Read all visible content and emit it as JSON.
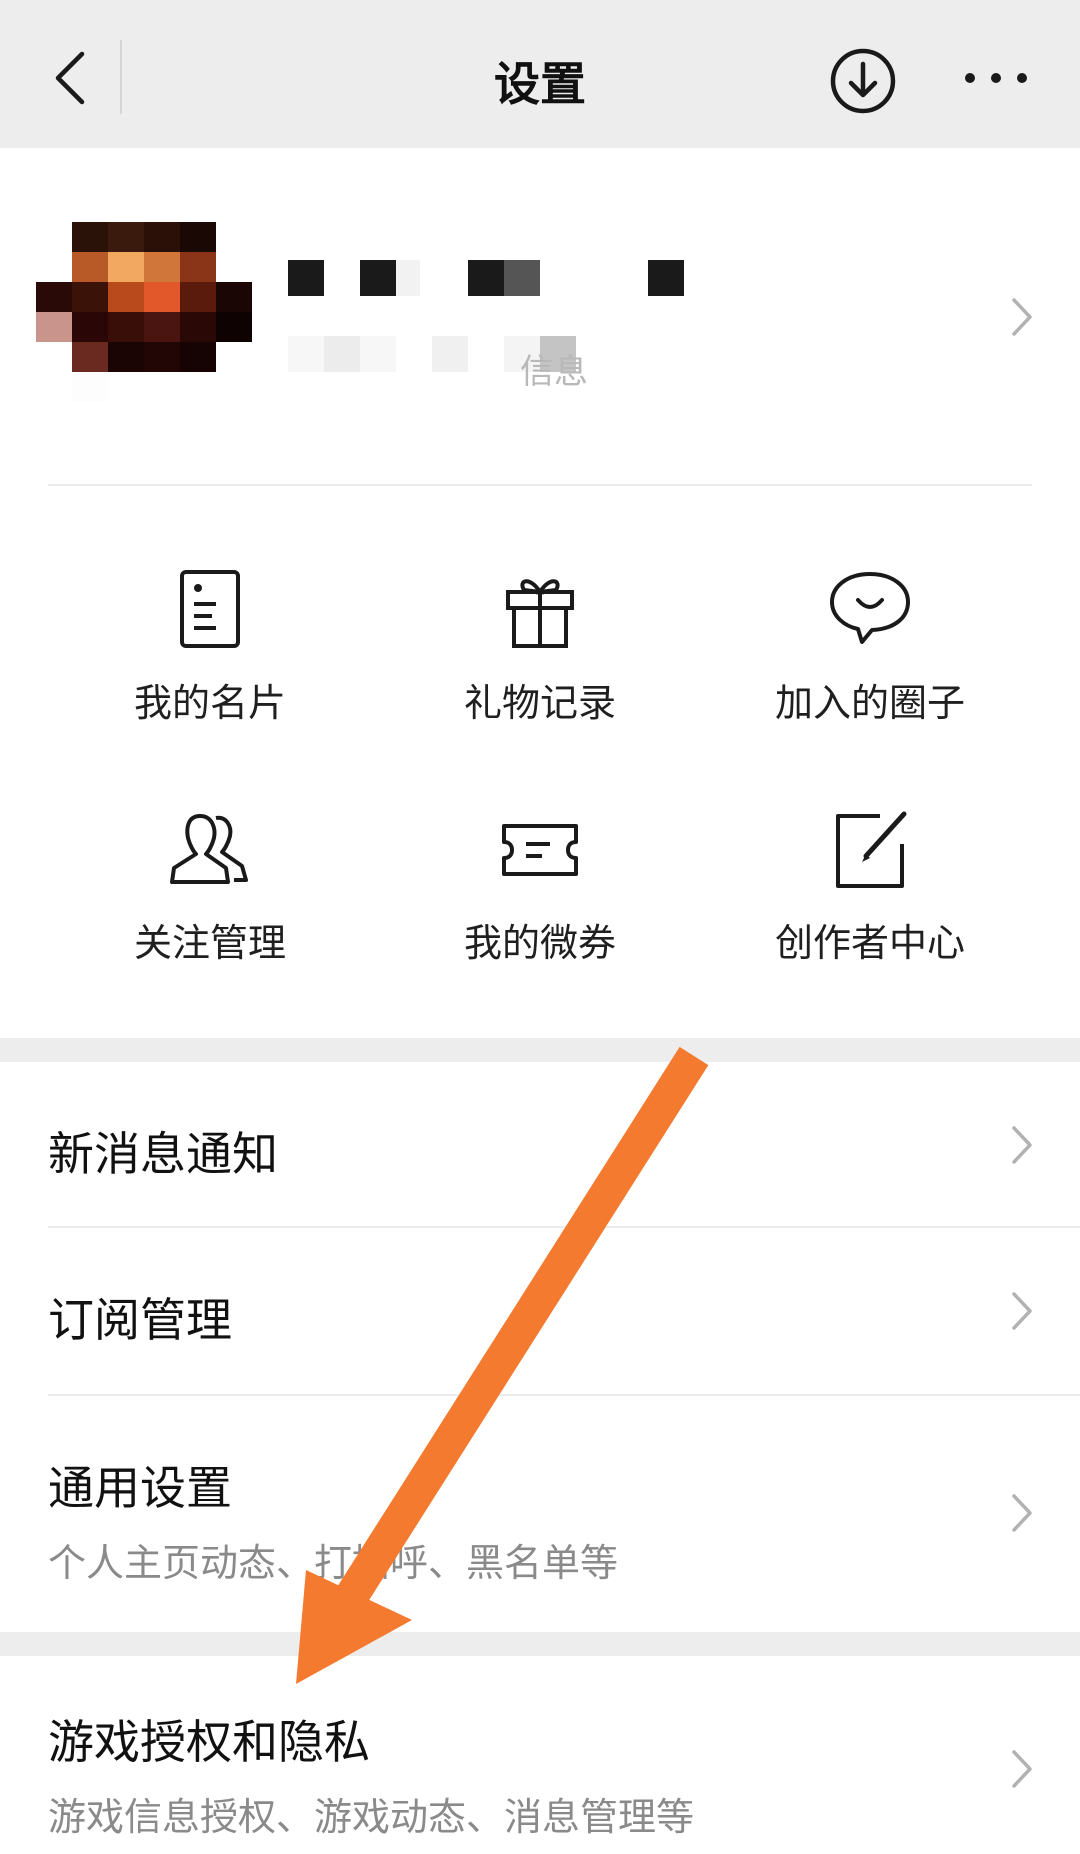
{
  "header": {
    "title": "设置",
    "back_icon": "back-chevron-icon",
    "download_icon": "download-circle-icon",
    "more_icon": "more-dots-icon"
  },
  "profile": {
    "description_fragment": "信息"
  },
  "grid": [
    {
      "label": "我的名片",
      "icon": "name-card-icon"
    },
    {
      "label": "礼物记录",
      "icon": "gift-icon"
    },
    {
      "label": "加入的圈子",
      "icon": "chat-bubble-icon"
    },
    {
      "label": "关注管理",
      "icon": "people-icon"
    },
    {
      "label": "我的微券",
      "icon": "coupon-icon"
    },
    {
      "label": "创作者中心",
      "icon": "edit-square-icon"
    }
  ],
  "rows": [
    {
      "title": "新消息通知"
    },
    {
      "title": "订阅管理"
    },
    {
      "title": "通用设置",
      "subtitle": "个人主页动态、打招呼、黑名单等"
    },
    {
      "title": "游戏授权和隐私",
      "subtitle": "游戏信息授权、游戏动态、消息管理等"
    }
  ],
  "colors": {
    "annotation_arrow": "#f47a30",
    "header_bg": "#ededed",
    "gap_bg": "#ededed",
    "subtitle_text": "#8a8a8a"
  }
}
